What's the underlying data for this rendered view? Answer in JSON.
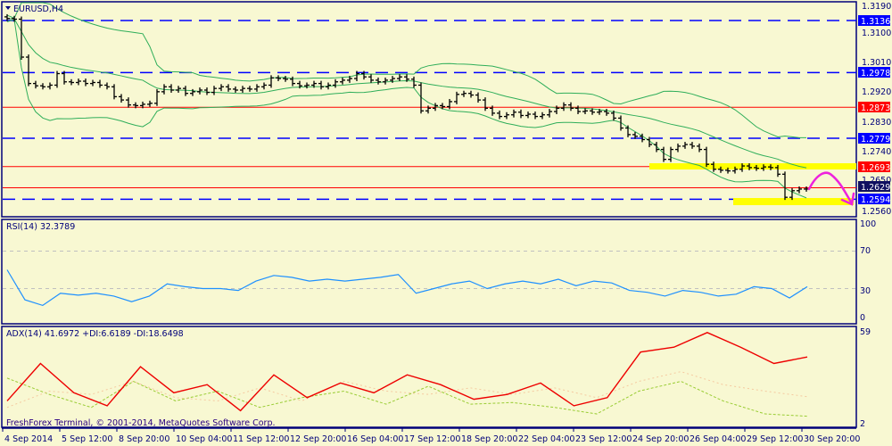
{
  "header": {
    "symbol_label": "EURUSD,H4",
    "menu_icon": "triangle-down-icon"
  },
  "copyright": "FreshForex Terminal, © 2001-2014, MetaQuotes Software Corp.",
  "colors": {
    "background": "#f8f8d2",
    "axis": "#00007a",
    "bars": "#000000",
    "bands": "#2fae5a",
    "support_level": "#0000ff",
    "resistance_level": "#ff0000",
    "highlight": "#ffff00",
    "arrow": "#ee22dd",
    "rsi": "#1e90ff",
    "adx": "#ee0000",
    "plus_di": "#99cc33",
    "minus_di": "#f5c9a0"
  },
  "price_axis": {
    "ticks": [
      "1.3190",
      "1.3100",
      "1.3010",
      "1.2920",
      "1.2830",
      "1.2740",
      "1.2650",
      "1.2560"
    ]
  },
  "levels": [
    {
      "label": "1.3136",
      "value": 1.3136,
      "type": "support"
    },
    {
      "label": "1.2978",
      "value": 1.2978,
      "type": "support"
    },
    {
      "label": "1.2873",
      "value": 1.2873,
      "type": "resistance"
    },
    {
      "label": "1.2779",
      "value": 1.2779,
      "type": "support"
    },
    {
      "label": "1.2693",
      "value": 1.2693,
      "type": "resistance"
    },
    {
      "label": "1.2629",
      "value": 1.2629,
      "type": "current"
    },
    {
      "label": "1.2594",
      "value": 1.2594,
      "type": "support"
    }
  ],
  "time_axis": {
    "labels": [
      "4 Sep 2014",
      "5 Sep 12:00",
      "8 Sep 20:00",
      "10 Sep 04:00",
      "11 Sep 12:00",
      "12 Sep 20:00",
      "16 Sep 04:00",
      "17 Sep 12:00",
      "18 Sep 20:00",
      "22 Sep 04:00",
      "23 Sep 12:00",
      "24 Sep 20:00",
      "26 Sep 04:00",
      "29 Sep 12:00",
      "30 Sep 20:00"
    ]
  },
  "rsi": {
    "label": "RSI(14) 32.3789",
    "ticks": [
      "100",
      "70",
      "30",
      "0"
    ]
  },
  "adx": {
    "label": "ADX(14) 41.6972 +DI:6.6189 -DI:18.6498",
    "ticks": [
      "59",
      "2"
    ]
  },
  "chart_data": [
    {
      "type": "line",
      "title": "EURUSD,H4",
      "ylim": [
        1.256,
        1.319
      ],
      "series": [
        {
          "name": "EURUSD close",
          "values": [
            1.3142,
            1.314,
            1.3025,
            1.2945,
            1.2938,
            1.2935,
            1.294,
            1.2975,
            1.295,
            1.2948,
            1.2952,
            1.2945,
            1.2948,
            1.294,
            1.2935,
            1.2905,
            1.2895,
            1.288,
            1.2878,
            1.2882,
            1.2885,
            1.292,
            1.2935,
            1.2925,
            1.293,
            1.2915,
            1.292,
            1.2925,
            1.2918,
            1.293,
            1.2935,
            1.2928,
            1.2925,
            1.293,
            1.2928,
            1.2935,
            1.294,
            1.2962,
            1.296,
            1.2958,
            1.2945,
            1.2938,
            1.294,
            1.2945,
            1.2935,
            1.294,
            1.295,
            1.2955,
            1.296,
            1.2975,
            1.2965,
            1.2955,
            1.295,
            1.2955,
            1.296,
            1.2965,
            1.2958,
            1.294,
            1.2862,
            1.287,
            1.2878,
            1.2875,
            1.289,
            1.2912,
            1.2915,
            1.291,
            1.2895,
            1.287,
            1.2855,
            1.2845,
            1.285,
            1.2858,
            1.2848,
            1.2852,
            1.2845,
            1.285,
            1.286,
            1.287,
            1.288,
            1.287,
            1.286,
            1.2862,
            1.2858,
            1.286,
            1.2855,
            1.284,
            1.281,
            1.279,
            1.2785,
            1.2775,
            1.276,
            1.2745,
            1.2715,
            1.2745,
            1.2755,
            1.276,
            1.2755,
            1.2745,
            1.27,
            1.2685,
            1.2682,
            1.268,
            1.2685,
            1.2695,
            1.269,
            1.2688,
            1.2692,
            1.269,
            1.267,
            1.26,
            1.262,
            1.2625,
            1.2625
          ]
        }
      ]
    },
    {
      "type": "line",
      "title": "RSI(14)",
      "ylim": [
        0,
        100
      ],
      "series": [
        {
          "name": "RSI(14)",
          "values": [
            50,
            18,
            12,
            25,
            23,
            25,
            22,
            16,
            22,
            35,
            32,
            30,
            30,
            28,
            38,
            44,
            42,
            38,
            40,
            38,
            40,
            42,
            45,
            25,
            30,
            35,
            38,
            30,
            35,
            38,
            35,
            40,
            33,
            38,
            36,
            28,
            26,
            22,
            28,
            26,
            22,
            24,
            32,
            30,
            20,
            32
          ]
        }
      ]
    },
    {
      "type": "line",
      "title": "ADX(14)",
      "ylim": [
        2,
        59
      ],
      "series": [
        {
          "name": "ADX",
          "values": [
            16,
            39,
            21,
            13,
            37,
            21,
            26,
            10,
            32,
            18,
            27,
            21,
            32,
            26,
            17,
            20,
            27,
            13,
            18,
            46,
            49,
            58,
            49,
            39,
            43
          ]
        },
        {
          "name": "+DI",
          "values": [
            30,
            20,
            12,
            28,
            16,
            22,
            12,
            18,
            22,
            14,
            25,
            14,
            15,
            12,
            8,
            22,
            28,
            16,
            8,
            6.6
          ]
        },
        {
          "name": "-DI",
          "values": [
            12,
            22,
            20,
            28,
            18,
            16,
            24,
            16,
            28,
            22,
            20,
            24,
            20,
            24,
            18,
            28,
            34,
            26,
            22,
            18.6
          ]
        }
      ]
    }
  ]
}
